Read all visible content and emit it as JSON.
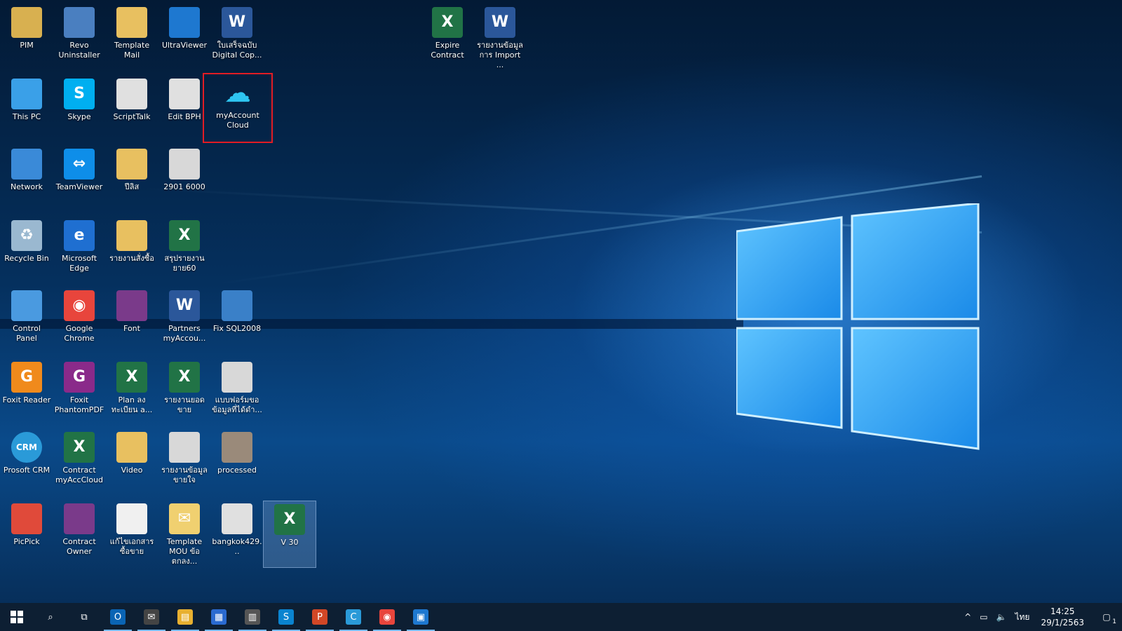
{
  "desktop_icons": [
    {
      "label": "PIM",
      "icon": "person-folder-icon",
      "color": "#d8b050"
    },
    {
      "label": "Revo Uninstaller",
      "icon": "uninstaller-icon",
      "color": "#4a7fc0"
    },
    {
      "label": "Template Mail",
      "icon": "folder-icon",
      "color": "#e8c060"
    },
    {
      "label": "UltraViewer",
      "icon": "remote-view-icon",
      "color": "#1e78d0"
    },
    {
      "label": "ใบเสร็จฉบับ Digital Cop...",
      "icon": "word-doc-icon",
      "color": "#2b579a"
    },
    {
      "label": "This PC",
      "icon": "computer-icon",
      "color": "#3aa0e8"
    },
    {
      "label": "Skype",
      "icon": "skype-icon",
      "color": "#00aff0"
    },
    {
      "label": "ScriptTalk",
      "icon": "blank-file-icon",
      "color": "#e0e0e0"
    },
    {
      "label": "Edit BPH",
      "icon": "blank-file-icon",
      "color": "#e0e0e0"
    },
    {
      "label": "myAccount Cloud",
      "icon": "cloud-icon",
      "color": "#0e4a8a"
    },
    {
      "label": "Network",
      "icon": "network-icon",
      "color": "#3a8ad8"
    },
    {
      "label": "TeamViewer",
      "icon": "teamviewer-icon",
      "color": "#0e8ee9"
    },
    {
      "label": "ปีลิส",
      "icon": "folder-icon",
      "color": "#e8c060"
    },
    {
      "label": "2901 6000",
      "icon": "image-file-icon",
      "color": "#d8d8d8"
    },
    {
      "label": "Recycle Bin",
      "icon": "recycle-bin-icon",
      "color": "#9ab8d0"
    },
    {
      "label": "Microsoft Edge",
      "icon": "edge-icon",
      "color": "#1f6fd1"
    },
    {
      "label": "รายงานสั่งซื้อ",
      "icon": "folder-icon",
      "color": "#e8c060"
    },
    {
      "label": "สรุปรายงาน ยาย60",
      "icon": "excel-icon",
      "color": "#217346"
    },
    {
      "label": "Control Panel",
      "icon": "control-panel-icon",
      "color": "#4a9ae0"
    },
    {
      "label": "Google Chrome",
      "icon": "chrome-icon",
      "color": "#e8453c"
    },
    {
      "label": "Font",
      "icon": "winrar-icon",
      "color": "#7a3a8a"
    },
    {
      "label": "Partners myAccou...",
      "icon": "word-doc-icon",
      "color": "#2b579a"
    },
    {
      "label": "Fix SQL2008",
      "icon": "script-icon",
      "color": "#3a80c8"
    },
    {
      "label": "Foxit Reader",
      "icon": "foxit-reader-icon",
      "color": "#f08a1c"
    },
    {
      "label": "Foxit PhantomPDF",
      "icon": "foxit-phantom-icon",
      "color": "#8a2a8a"
    },
    {
      "label": "Plan ลงทะเบียน a...",
      "icon": "excel-icon",
      "color": "#217346"
    },
    {
      "label": "รายงานยอด ขาย",
      "icon": "excel-icon",
      "color": "#217346"
    },
    {
      "label": "แบบฟอร์มขอ ข้อมูลที่ได้ดำ...",
      "icon": "pdf-file-icon",
      "color": "#d8d8d8"
    },
    {
      "label": "Prosoft CRM",
      "icon": "crm-icon",
      "color": "#2a9ad8"
    },
    {
      "label": "Contract myAccCloud",
      "icon": "excel-icon",
      "color": "#217346"
    },
    {
      "label": "Video",
      "icon": "folder-icon",
      "color": "#e8c060"
    },
    {
      "label": "รายงานข้อมูล ขายใจ",
      "icon": "pdf-file-icon",
      "color": "#d8d8d8"
    },
    {
      "label": "processed",
      "icon": "image-file-icon",
      "color": "#9a8a7a"
    },
    {
      "label": "PicPick",
      "icon": "picpick-icon",
      "color": "#e04a3a"
    },
    {
      "label": "Contract Owner",
      "icon": "winrar-icon",
      "color": "#7a3a8a"
    },
    {
      "label": "แก้ไขเอกสารซื้อขาย",
      "icon": "blank-file-icon",
      "color": "#f0f0f0"
    },
    {
      "label": "Template MOU ข้อตกลง...",
      "icon": "mail-icon",
      "color": "#f0d070"
    },
    {
      "label": "bangkok429...",
      "icon": "pdf-file-icon",
      "color": "#e0e0e0"
    },
    {
      "label": "V 30",
      "icon": "excel-icon",
      "color": "#217346"
    },
    {
      "label": "Expire Contract",
      "icon": "excel-icon",
      "color": "#217346"
    },
    {
      "label": "รายงานข้อมูล การ Import ...",
      "icon": "word-doc-icon",
      "color": "#2b579a"
    }
  ],
  "taskbar": {
    "start": "windows-start-icon",
    "items": [
      {
        "icon": "search-icon",
        "glyph": "⌕",
        "color": "transparent"
      },
      {
        "icon": "task-view-icon",
        "glyph": "⧉",
        "color": "transparent"
      },
      {
        "icon": "outlook-icon",
        "glyph": "O",
        "color": "#0a64b4"
      },
      {
        "icon": "mail-briefcase-icon",
        "glyph": "✉",
        "color": "#444"
      },
      {
        "icon": "file-explorer-icon",
        "glyph": "▤",
        "color": "#e8b030"
      },
      {
        "icon": "store-icon",
        "glyph": "▦",
        "color": "#2a6ad0"
      },
      {
        "icon": "calculator-icon",
        "glyph": "▥",
        "color": "#555"
      },
      {
        "icon": "skype-taskbar-icon",
        "glyph": "S",
        "color": "#0a84d0"
      },
      {
        "icon": "powerpoint-icon",
        "glyph": "P",
        "color": "#d24726"
      },
      {
        "icon": "crm-taskbar-icon",
        "glyph": "C",
        "color": "#2a9ad8"
      },
      {
        "icon": "chrome-taskbar-icon",
        "glyph": "◉",
        "color": "#e8453c"
      },
      {
        "icon": "remote-taskbar-icon",
        "glyph": "▣",
        "color": "#1e78d0"
      }
    ],
    "tray": {
      "language": "ไทย",
      "time": "14:25",
      "date": "29/1/2563",
      "notification_count": "1"
    }
  }
}
